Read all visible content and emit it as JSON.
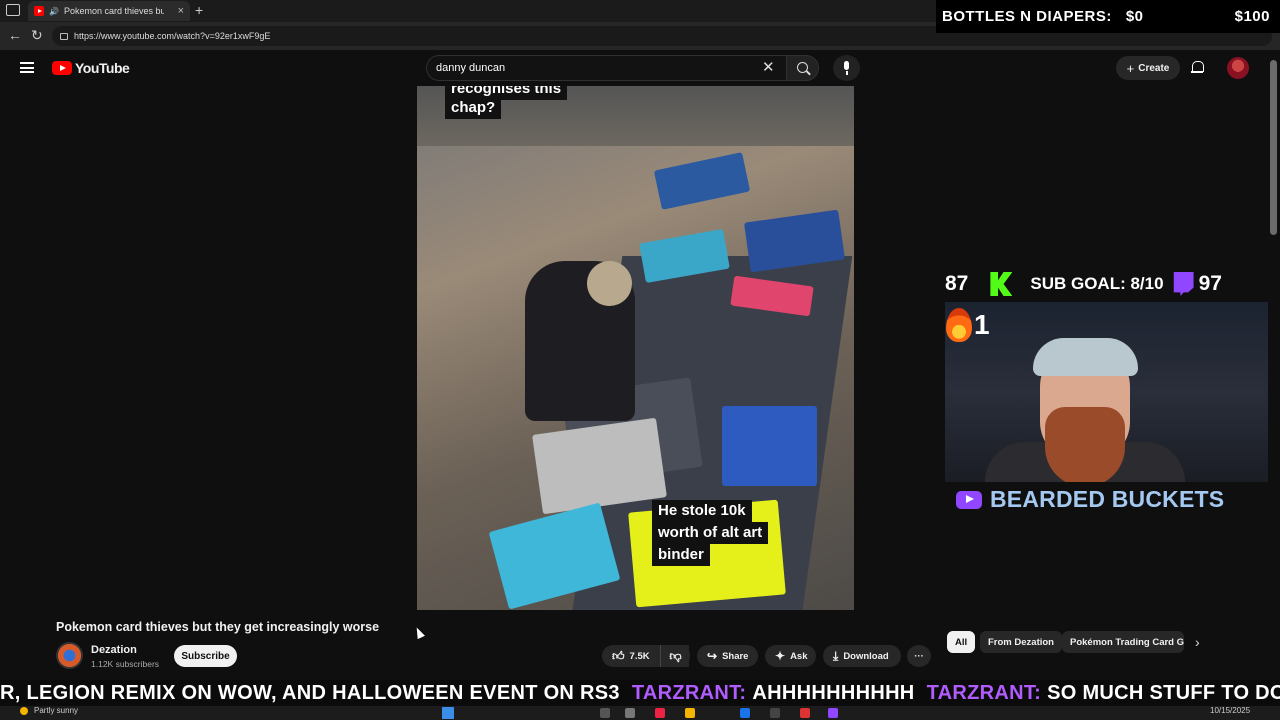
{
  "browser": {
    "tab_title": "Pokemon card thieves but the",
    "url": "https://www.youtube.com/watch?v=92er1xwF9gE"
  },
  "overlay_top": {
    "label": "BOTTLES N DIAPERS:",
    "current": "$0",
    "goal": "$100"
  },
  "youtube": {
    "logo_text": "YouTube",
    "search_value": "danny duncan",
    "create_label": "Create"
  },
  "video": {
    "caption_top_1": "recognises this",
    "caption_top_2": "chap?",
    "caption_bottom_1": "He stole 10k",
    "caption_bottom_2": "worth of alt art",
    "caption_bottom_3": "binder",
    "title": "Pokemon card thieves but they get increasingly worse"
  },
  "channel": {
    "name": "Dezation",
    "subscribers": "1.12K subscribers",
    "subscribe_label": "Subscribe"
  },
  "actions": {
    "like_count": "7.5K",
    "share_label": "Share",
    "ask_label": "Ask",
    "download_label": "Download",
    "more_label": "···"
  },
  "chips": {
    "all": "All",
    "from": "From Dezation",
    "tcg": "Pokémon Trading Card Ga"
  },
  "stream_overlay": {
    "kick_count": "87",
    "sub_goal": "SUB GOAL: 8/10",
    "twitch_count": "97",
    "fire_count": "1",
    "channel_name": "BEARDED BUCKETS"
  },
  "ticker": {
    "text_1": "R, LEGION REMIX ON WOW, AND HALLOWEEN EVENT ON RS3",
    "name_1": "TARZRANT:",
    "msg_1": "AHHHHHHHHHH",
    "name_2": "TARZRANT:",
    "msg_2": "SO MUCH STUFF TO DO"
  },
  "taskbar": {
    "weather": "Partly sunny",
    "date": "10/15/2025"
  },
  "colors": {
    "youtube_red": "#ff0000",
    "kick_green": "#53fc18",
    "twitch_purple": "#9146ff"
  }
}
